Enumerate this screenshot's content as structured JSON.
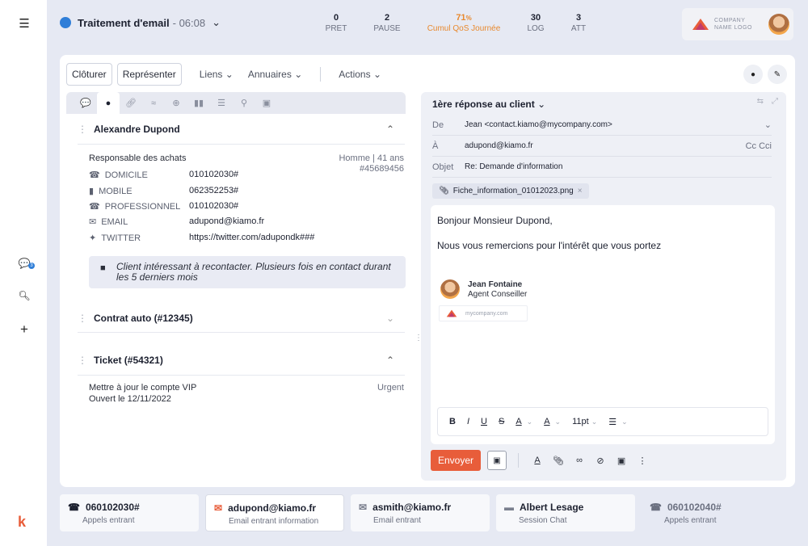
{
  "topbar": {
    "status_label": "Traitement d'email",
    "status_time": "- 06:08",
    "kpis": [
      {
        "value": "0",
        "label": "PRET"
      },
      {
        "value": "2",
        "label": "PAUSE"
      },
      {
        "value": "71",
        "unit": "%",
        "label": "Cumul QoS Journée"
      },
      {
        "value": "30",
        "label": "LOG"
      },
      {
        "value": "3",
        "label": "ATT"
      }
    ],
    "logo_line1": "COMPANY",
    "logo_line2": "NAME LOGO"
  },
  "rail": {
    "badge": "3",
    "brand": "k"
  },
  "toolbar": {
    "close_label": "Clôturer",
    "represent_label": "Représenter",
    "links_label": "Liens",
    "directories_label": "Annuaires",
    "actions_label": "Actions"
  },
  "contact": {
    "name": "Alexandre Dupond",
    "title": "Responsable des achats",
    "gender_age": "Homme | 41 ans",
    "id": "#45689456",
    "rows": [
      {
        "label": "DOMICILE",
        "value": "010102030#"
      },
      {
        "label": "MOBILE",
        "value": "062352253#"
      },
      {
        "label": "PROFESSIONNEL",
        "value": "010102030#"
      },
      {
        "label": "EMAIL",
        "value": "adupond@kiamo.fr"
      },
      {
        "label": "TWITTER",
        "value": "https://twitter.com/adupondk###"
      }
    ],
    "note": "Client intéressant à recontacter. Plusieurs fois en contact durant les 5 derniers mois"
  },
  "contract": {
    "title": "Contrat auto (#12345)"
  },
  "ticket": {
    "title": "Ticket (#54321)",
    "line1": "Mettre à jour le compte VIP",
    "priority": "Urgent",
    "line2": "Ouvert le 12/11/2022"
  },
  "mail": {
    "header": "1ère réponse au client",
    "from_label": "De",
    "from_value": "Jean <contact.kiamo@mycompany.com>",
    "to_label": "À",
    "to_value": "adupond@kiamo.fr",
    "cc_label": "Cc Cci",
    "subject_label": "Objet",
    "subject_value": "Re: Demande d'information",
    "attachment": "Fiche_information_01012023.png",
    "body_line1": "Bonjour Monsieur Dupond,",
    "body_line2": "Nous vous remercions pour l'intérêt que vous portez",
    "sig_name": "Jean Fontaine",
    "sig_role": "Agent Conseiller",
    "sig_site": "mycompany.com",
    "font_size": "11pt",
    "send_label": "Envoyer"
  },
  "bottom_tabs": [
    {
      "title": "060102030#",
      "subtitle": "Appels entrant"
    },
    {
      "title": "adupond@kiamo.fr",
      "subtitle": "Email entrant information"
    },
    {
      "title": "asmith@kiamo.fr",
      "subtitle": "Email entrant"
    },
    {
      "title": "Albert Lesage",
      "subtitle": "Session Chat"
    },
    {
      "title": "060102040#",
      "subtitle": "Appels entrant"
    }
  ],
  "colors": {
    "accent": "#e85d3a",
    "status": "#2f7ed8",
    "qos": "#e8892e"
  }
}
